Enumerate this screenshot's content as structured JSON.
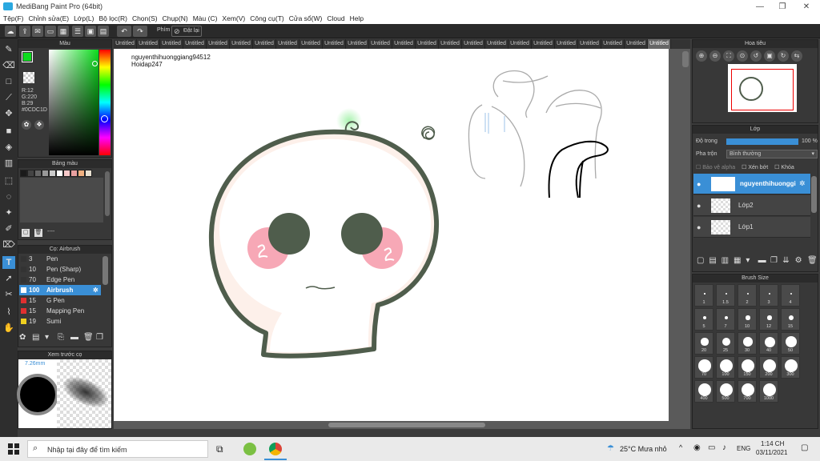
{
  "window": {
    "title": "MediBang Paint Pro (64bit)"
  },
  "menu": [
    "Tệp(F)",
    "Chỉnh sửa(E)",
    "Lớp(L)",
    "Bộ lọc(R)",
    "Chọn(S)",
    "Chụp(N)",
    "Màu (C)",
    "Xem(V)",
    "Công cụ(T)",
    "Cửa sổ(W)",
    "Cloud",
    "Help"
  ],
  "toolbar": {
    "shortcut_label": "Phím",
    "reset_label": "Đặt lại"
  },
  "tabs": [
    "Untitled",
    "Untitled",
    "Untitled",
    "Untitled",
    "Untitled",
    "Untitled",
    "Untitled",
    "Untitled",
    "Untitled",
    "Untitled",
    "Untitled",
    "Untitled",
    "Untitled",
    "Untitled",
    "Untitled",
    "Untitled",
    "Untitled",
    "Untitled",
    "Untitled",
    "Untitled",
    "Untitled",
    "Untitled",
    "Untitled",
    "Untitled"
  ],
  "color_panel": {
    "title": "Màu",
    "r": "R:12",
    "g": "G:220",
    "b": "B:29",
    "hex": "#0CDC1D",
    "fg_color": "#0CDC1D"
  },
  "palette_panel": {
    "title": "Bảng màu",
    "swatches": [
      "#1a1a1a",
      "#444444",
      "#666666",
      "#999999",
      "#cccccc",
      "#ffffff",
      "#f6c8c8",
      "#e8a0a0",
      "#f0b080",
      "#e8e0d0"
    ],
    "page_label": "----"
  },
  "brush_panel": {
    "title": "Cọ: Airbrush",
    "brushes": [
      {
        "size": "3",
        "name": "Pen",
        "color": "#333333"
      },
      {
        "size": "10",
        "name": "Pen (Sharp)",
        "color": "#333333"
      },
      {
        "size": "70",
        "name": "Edge Pen",
        "color": "#333333"
      },
      {
        "size": "100",
        "name": "Airbrush",
        "color": "#ffffff"
      },
      {
        "size": "15",
        "name": "G Pen",
        "color": "#e03030"
      },
      {
        "size": "15",
        "name": "Mapping Pen",
        "color": "#e03030"
      },
      {
        "size": "19",
        "name": "Sumi",
        "color": "#f0d020"
      }
    ]
  },
  "preview_panel": {
    "title": "Xem trước cọ",
    "size_label": "7.26mm"
  },
  "canvas": {
    "username": "nguyenthihuonggiang94512",
    "site": "Hoidap247"
  },
  "navigator": {
    "title": "Hoa tiêu"
  },
  "layers_panel": {
    "title": "Lớp",
    "opacity_label": "Độ trong",
    "opacity_value": "100 %",
    "opacity_fraction": 1.0,
    "blend_label": "Pha trộn",
    "blend_value": "Bình thường",
    "protect_alpha": "Bảo vệ alpha",
    "clipping": "Xén bớt",
    "lock": "Khóa",
    "layers": [
      {
        "name": "nguyenthihuonggi"
      },
      {
        "name": "Lớp2"
      },
      {
        "name": "Lớp1"
      }
    ]
  },
  "brush_size_panel": {
    "title": "Brush Size",
    "sizes": [
      "1",
      "1.5",
      "2",
      "3",
      "4",
      "5",
      "7",
      "10",
      "12",
      "15",
      "20",
      "25",
      "30",
      "40",
      "50",
      "70",
      "100",
      "150",
      "200",
      "300",
      "400",
      "500",
      "700",
      "1000"
    ]
  },
  "taskbar": {
    "search_placeholder": "Nhập tại đây để tìm kiếm",
    "weather": "25°C  Mưa nhỏ",
    "language": "ENG",
    "time": "1:14 CH",
    "date": "03/11/2021"
  }
}
